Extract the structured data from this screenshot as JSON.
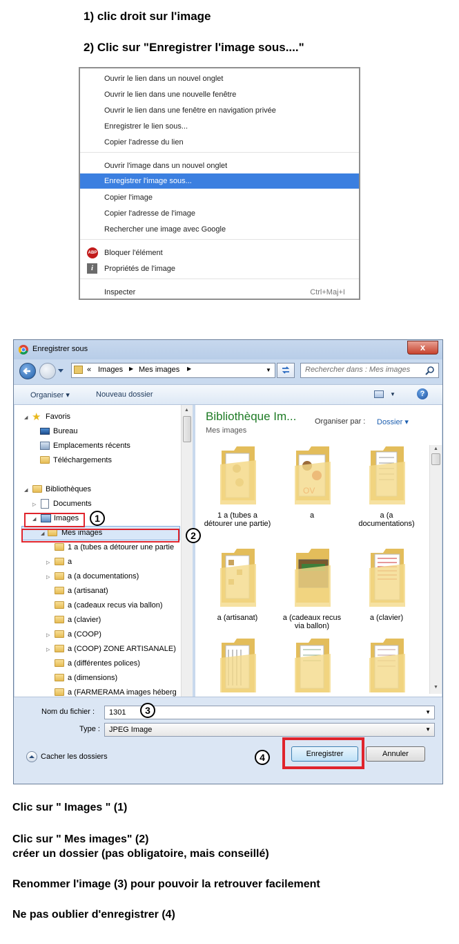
{
  "steps_top": {
    "step1": "1) clic droit sur l'image",
    "step2": "2) Clic sur \"Enregistrer l'image sous....\""
  },
  "context_menu": {
    "group1": [
      "Ouvrir le lien dans un nouvel onglet",
      "Ouvrir le lien dans une nouvelle fenêtre",
      "Ouvrir le lien dans une fenêtre en navigation privée",
      "Enregistrer le lien sous...",
      "Copier l'adresse du lien"
    ],
    "group2": [
      "Ouvrir l'image dans un nouvel onglet",
      "Enregistrer l'image sous...",
      "Copier l'image",
      "Copier l'adresse de l'image",
      "Rechercher une image avec Google"
    ],
    "highlighted": "Enregistrer l'image sous...",
    "block": "Bloquer l'élément",
    "block_icon": "ABP",
    "props": "Propriétés de l'image",
    "props_icon": "i",
    "inspect": "Inspecter",
    "inspect_shortcut": "Ctrl+Maj+I"
  },
  "dialog": {
    "title": "Enregistrer sous",
    "close": "x",
    "breadcrumb": {
      "sep": "«",
      "part1": "Images",
      "part2": "Mes images"
    },
    "search_placeholder": "Rechercher dans : Mes images",
    "toolbar": {
      "organiser": "Organiser ▾",
      "new_folder": "Nouveau dossier"
    },
    "tree": {
      "favoris": "Favoris",
      "bureau": "Bureau",
      "recents": "Emplacements récents",
      "telech": "Téléchargements",
      "biblio": "Bibliothèques",
      "documents": "Documents",
      "images": "Images",
      "mes_images": "Mes images",
      "folders": [
        "1 a (tubes a détourer une partie",
        "a",
        "a (a documentations)",
        "a (artisanat)",
        "a (cadeaux recus via ballon)",
        "a (clavier)",
        "a (COOP)",
        "a (COOP) ZONE  ARTISANALE)",
        "a (différentes polices)",
        "a (dimensions)",
        "a (FARMERAMA images héberg"
      ]
    },
    "library": {
      "title": "Bibliothèque Im...",
      "subtitle": "Mes images",
      "arrange_label": "Organiser par :",
      "arrange_value": "Dossier ▾"
    },
    "tiles": [
      "1 a (tubes a détourer une partie)",
      "a",
      "a (a documentations)",
      "a (artisanat)",
      "a (cadeaux recus via ballon)",
      "a (clavier)",
      "",
      "",
      ""
    ],
    "filename_label": "Nom du fichier :",
    "filename": "1301",
    "type_label": "Type :",
    "type_value": "JPEG Image",
    "hide_folders": "Cacher les dossiers",
    "save": "Enregistrer",
    "cancel": "Annuler"
  },
  "badges": [
    "1",
    "2",
    "3",
    "4"
  ],
  "instructions": {
    "l1": "Clic sur \" Images \" (1)",
    "l2": "Clic sur \" Mes images\" (2)",
    "l3": "créer un dossier (pas obligatoire, mais conseillé)",
    "l4": "Renommer l'image  (3) pour pouvoir la retrouver facilement",
    "l5": "Ne pas oublier d'enregistrer (4)"
  },
  "colors": {
    "highlight": "#3b7fe0",
    "annotation": "#e0242c",
    "library_title": "#1e7b25"
  }
}
